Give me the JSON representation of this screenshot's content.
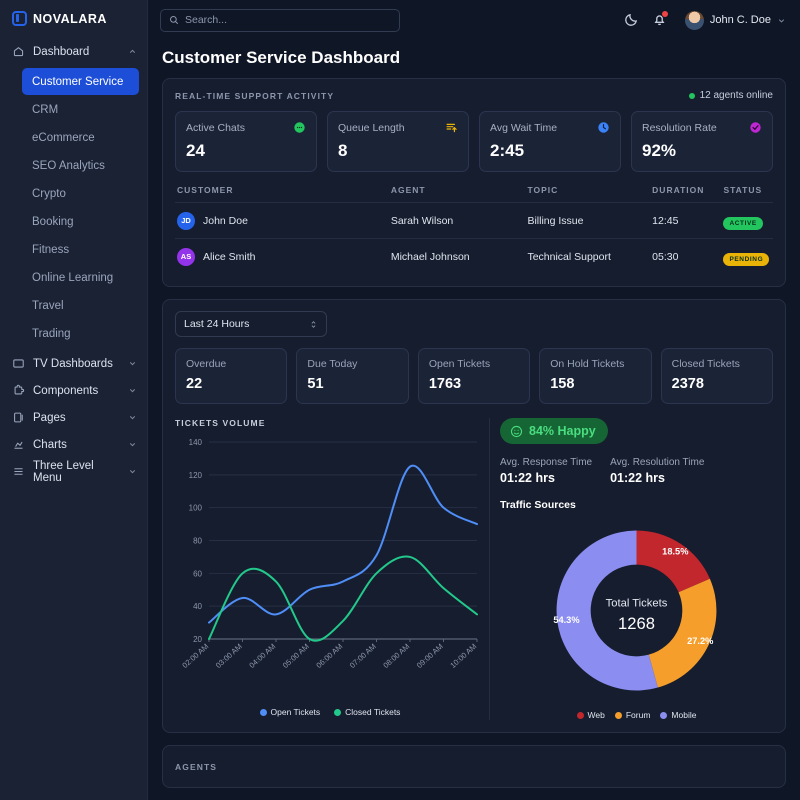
{
  "brand": {
    "name": "NOVALARA",
    "logo_icon": "novalara-logo-icon"
  },
  "sidebar": {
    "groups": [
      {
        "label": "Dashboard",
        "icon": "home-icon",
        "chevron": "chevron-up-icon",
        "expanded": true,
        "items": [
          {
            "label": "Customer Service",
            "active": true
          },
          {
            "label": "CRM",
            "active": false
          },
          {
            "label": "eCommerce",
            "active": false
          },
          {
            "label": "SEO Analytics",
            "active": false
          },
          {
            "label": "Crypto",
            "active": false
          },
          {
            "label": "Booking",
            "active": false
          },
          {
            "label": "Fitness",
            "active": false
          },
          {
            "label": "Online Learning",
            "active": false
          },
          {
            "label": "Travel",
            "active": false
          },
          {
            "label": "Trading",
            "active": false
          }
        ]
      },
      {
        "label": "TV Dashboards",
        "icon": "tv-icon",
        "chevron": "chevron-down-icon",
        "expanded": false,
        "items": []
      },
      {
        "label": "Components",
        "icon": "puzzle-icon",
        "chevron": "chevron-down-icon",
        "expanded": false,
        "items": []
      },
      {
        "label": "Pages",
        "icon": "pages-icon",
        "chevron": "chevron-down-icon",
        "expanded": false,
        "items": []
      },
      {
        "label": "Charts",
        "icon": "chart-icon",
        "chevron": "chevron-down-icon",
        "expanded": false,
        "items": []
      },
      {
        "label": "Three Level Menu",
        "icon": "menu-icon",
        "chevron": "chevron-down-icon",
        "expanded": false,
        "items": []
      }
    ]
  },
  "topbar": {
    "search_placeholder": "Search...",
    "theme_icon": "moon-icon",
    "notifications_icon": "bell-icon",
    "notifications_has_dot": true,
    "user_name": "John C. Doe",
    "user_chevron": "chevron-down-icon",
    "avatar_icon": "user-avatar"
  },
  "page": {
    "title": "Customer Service Dashboard"
  },
  "realtime": {
    "caption": "REAL-TIME SUPPORT ACTIVITY",
    "agents_online": "12 agents online",
    "status_color": "#22c55e",
    "stats": [
      {
        "label": "Active Chats",
        "value": "24",
        "icon": "chat-bubble-icon",
        "color": "#22c55e"
      },
      {
        "label": "Queue Length",
        "value": "8",
        "icon": "list-plus-icon",
        "color": "#eab308"
      },
      {
        "label": "Avg Wait Time",
        "value": "2:45",
        "icon": "clock-icon",
        "color": "#3b82f6"
      },
      {
        "label": "Resolution Rate",
        "value": "92%",
        "icon": "check-circle-icon",
        "color": "#c026d3"
      }
    ],
    "table": {
      "columns": [
        "CUSTOMER",
        "AGENT",
        "TOPIC",
        "DURATION",
        "STATUS"
      ],
      "rows": [
        {
          "initials": "JD",
          "avatar_color": "#2563eb",
          "customer": "John Doe",
          "agent": "Sarah Wilson",
          "topic": "Billing Issue",
          "duration": "12:45",
          "status": "ACTIVE",
          "status_bg": "#22c55e"
        },
        {
          "initials": "AS",
          "avatar_color": "#9333ea",
          "customer": "Alice Smith",
          "agent": "Michael Johnson",
          "topic": "Technical Support",
          "duration": "05:30",
          "status": "PENDING",
          "status_bg": "#eab308"
        }
      ]
    }
  },
  "tickets": {
    "range_selected": "Last 24 Hours",
    "range_icon": "chevron-updown-icon",
    "cards": [
      {
        "label": "Overdue",
        "value": "22"
      },
      {
        "label": "Due Today",
        "value": "51"
      },
      {
        "label": "Open Tickets",
        "value": "1763"
      },
      {
        "label": "On Hold Tickets",
        "value": "158"
      },
      {
        "label": "Closed Tickets",
        "value": "2378"
      }
    ]
  },
  "satisfaction": {
    "happy_icon": "smiley-icon",
    "happy_label": "84% Happy",
    "happy_color": "#4ade80",
    "response": {
      "label": "Avg. Response Time",
      "value": "01:22 hrs"
    },
    "resolution": {
      "label": "Avg. Resolution Time",
      "value": "01:22 hrs"
    },
    "traffic_title": "Traffic Sources"
  },
  "chart_data": [
    {
      "type": "line",
      "title": "TICKETS VOLUME",
      "xlabel": "",
      "ylabel": "",
      "ylim": [
        20,
        140
      ],
      "yticks": [
        20,
        40,
        60,
        80,
        100,
        120,
        140
      ],
      "grid": true,
      "legend_position": "bottom",
      "x": [
        "02:00 AM",
        "03:00 AM",
        "04:00 AM",
        "05:00 AM",
        "06:00 AM",
        "07:00 AM",
        "08:00 AM",
        "09:00 AM",
        "10:00 AM"
      ],
      "series": [
        {
          "name": "Open Tickets",
          "color": "#4f8ef7",
          "values": [
            30,
            45,
            35,
            50,
            55,
            71,
            125,
            100,
            90
          ]
        },
        {
          "name": "Closed Tickets",
          "color": "#22c98a",
          "values": [
            20,
            60,
            55,
            20,
            31,
            60,
            70,
            51,
            35
          ]
        }
      ]
    },
    {
      "type": "pie",
      "title": "Traffic Sources",
      "center_label": "Total Tickets",
      "center_value": "1268",
      "legend_position": "bottom",
      "labels": [
        "Web",
        "Forum",
        "Mobile"
      ],
      "values": [
        18.5,
        27.2,
        54.3
      ],
      "value_labels": [
        "18.5%",
        "27.2%",
        "54.3%"
      ],
      "colors": [
        "#c1272d",
        "#f59e2c",
        "#8b8ef0"
      ]
    }
  ],
  "agents": {
    "caption": "AGENTS"
  }
}
